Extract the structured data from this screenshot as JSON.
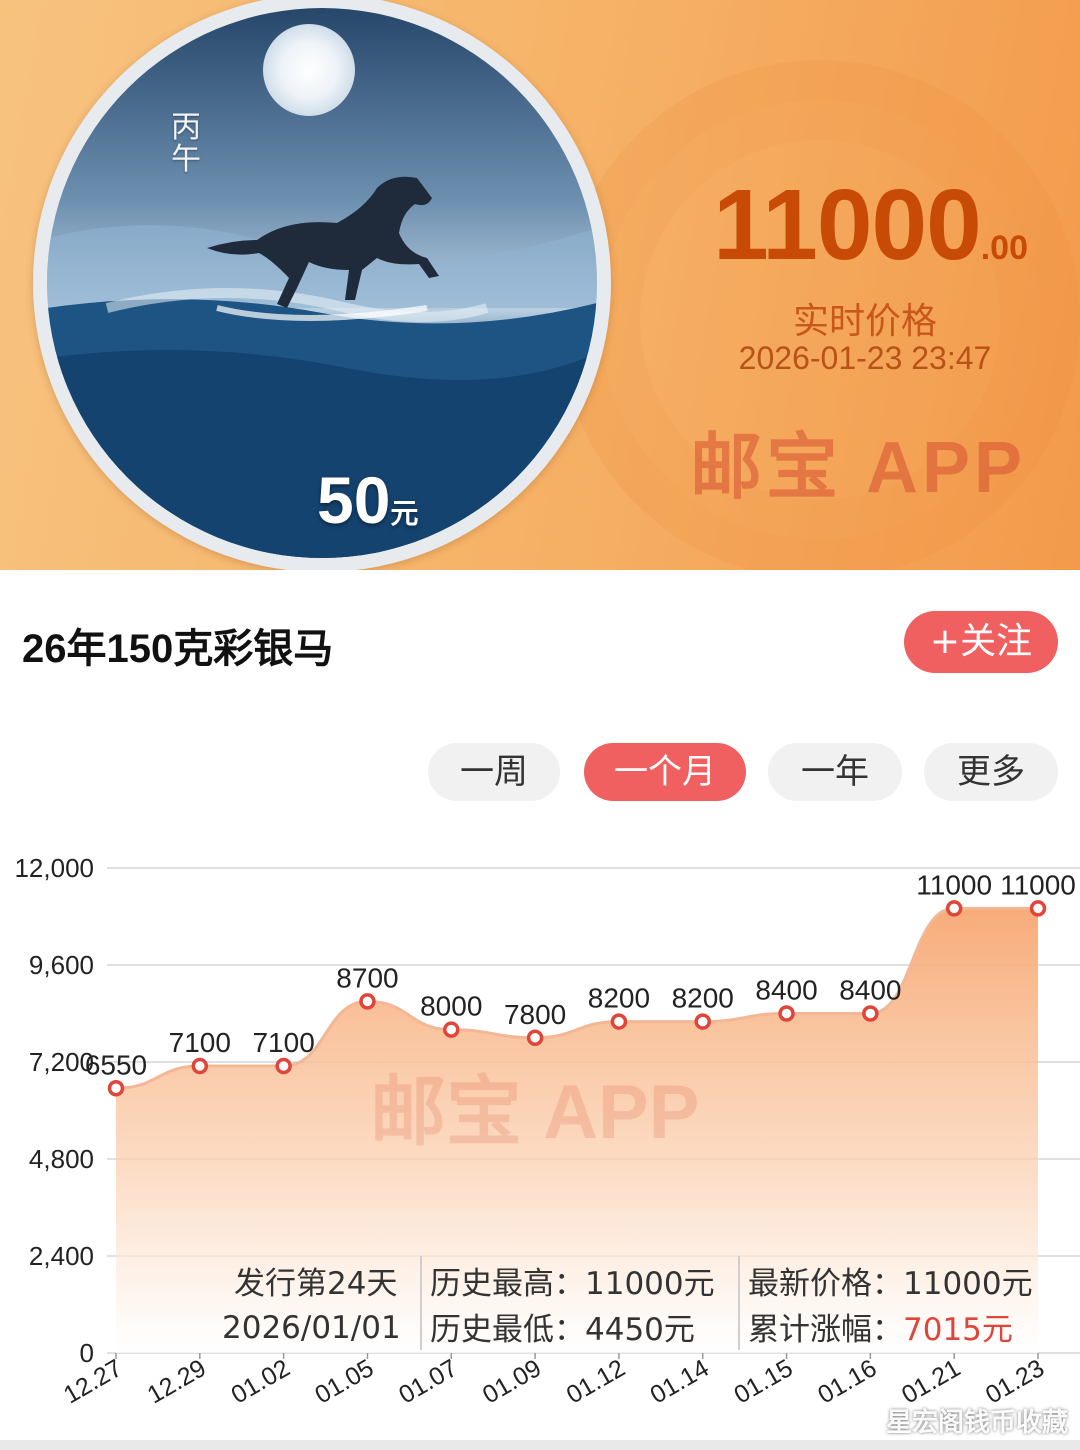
{
  "hero": {
    "coin_year_text": "丙午",
    "coin_denomination": "50",
    "coin_denomination_unit": "元",
    "price_integer": "11000",
    "price_decimal": ".00",
    "price_label": "实时价格",
    "price_timestamp": "2026-01-23 23:47",
    "watermark": "邮宝 APP",
    "colors": {
      "price": "#c74a06",
      "banner_start": "#f7c27f",
      "banner_end": "#f39a4c"
    }
  },
  "product": {
    "title": "26年150克彩银马",
    "follow_label": "+关注"
  },
  "period_tabs": [
    {
      "label": "一周",
      "active": false
    },
    {
      "label": "一个月",
      "active": true
    },
    {
      "label": "一年",
      "active": false
    },
    {
      "label": "更多",
      "active": false
    }
  ],
  "chart_data": {
    "type": "area",
    "categories": [
      "12.27",
      "12.29",
      "01.02",
      "01.05",
      "01.07",
      "01.09",
      "01.12",
      "01.14",
      "01.15",
      "01.16",
      "01.21",
      "01.23"
    ],
    "values": [
      6550,
      7100,
      7100,
      8700,
      8000,
      7800,
      8200,
      8200,
      8400,
      8400,
      11000,
      11000
    ],
    "ylim": [
      0,
      12000
    ],
    "y_ticks": [
      "0",
      "2,400",
      "4,800",
      "7,200",
      "9,600",
      "12,000"
    ],
    "y_tick_values": [
      0,
      2400,
      4800,
      7200,
      9600,
      12000
    ],
    "grid": true,
    "watermark": "邮宝 APP",
    "colors": {
      "fill_top": "#f7a772",
      "line": "#f3b796",
      "marker": "#e0453a"
    }
  },
  "stats": {
    "issue_days": "发行第24天",
    "issue_date": "2026/01/01",
    "high_label": "历史最高：",
    "high_value": "11000元",
    "low_label": "历史最低：",
    "low_value": "4450元",
    "latest_label": "最新价格：",
    "latest_value": "11000元",
    "rise_label": "累计涨幅：",
    "rise_value": "7015元"
  },
  "footer": {
    "watermark": "星宏阁钱币收藏"
  }
}
